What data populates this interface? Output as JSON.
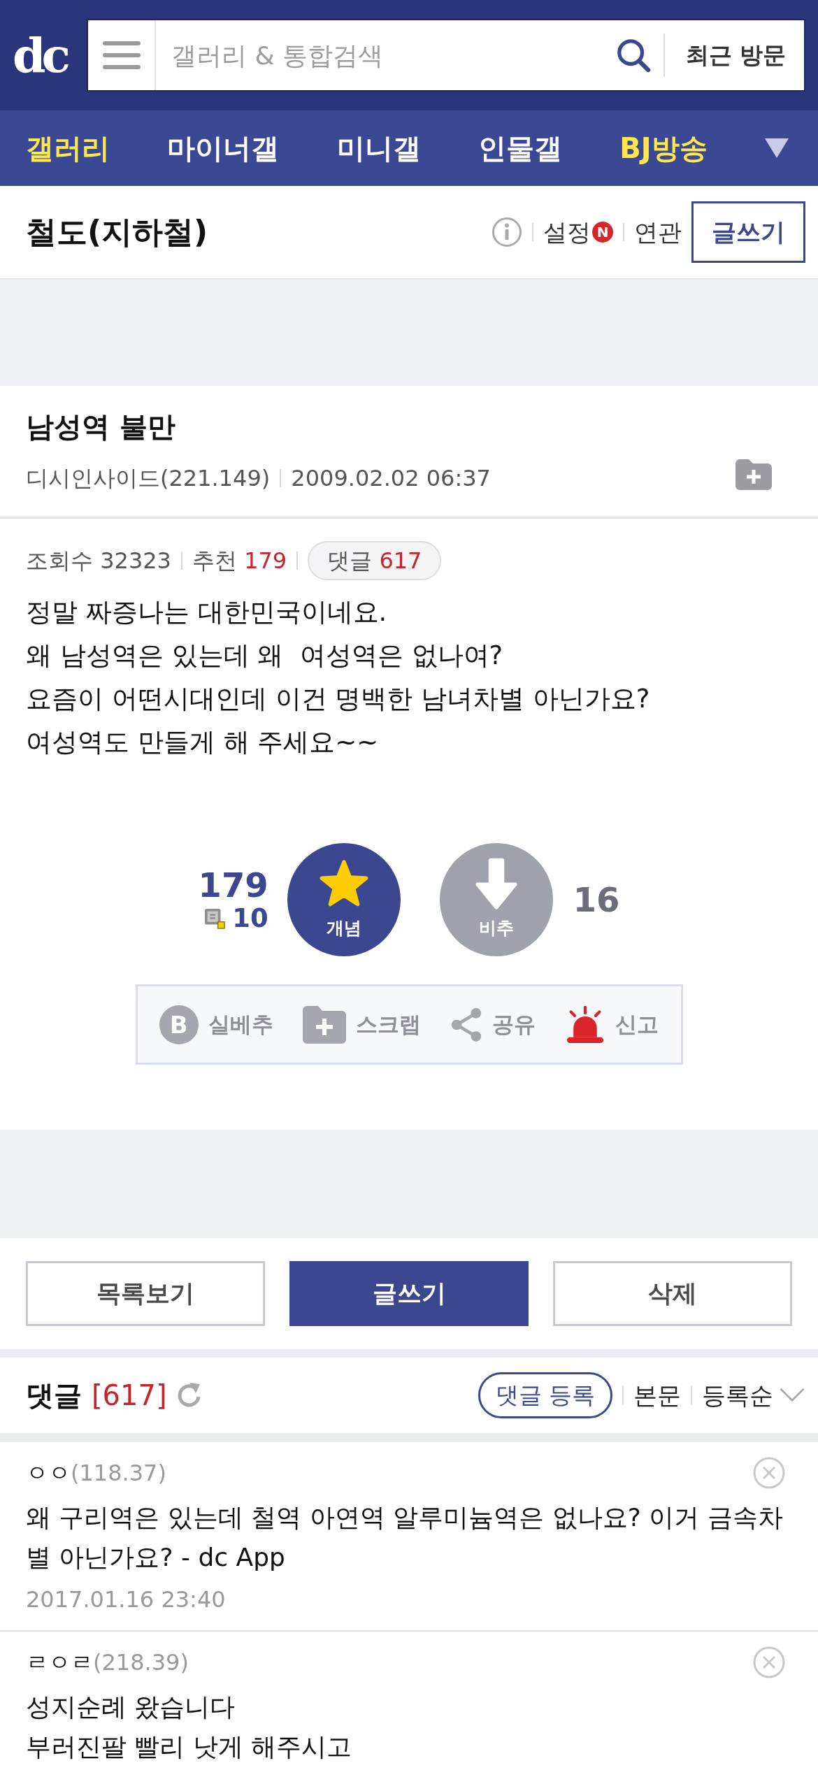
{
  "header": {
    "logo": "dc",
    "search": {
      "placeholder": "갤러리 & 통합검색"
    },
    "recent_button": "최근 방문"
  },
  "nav_tabs": [
    {
      "label": "갤러리",
      "color": "#ffe94a"
    },
    {
      "label": "마이너갤",
      "color": "#ffffff"
    },
    {
      "label": "미니갤",
      "color": "#ffffff"
    },
    {
      "label": "인물갤",
      "color": "#ffffff"
    },
    {
      "label": "BJ방송",
      "color": "#ffe94a"
    }
  ],
  "gallery": {
    "title": "철도(지하철)",
    "settings": {
      "label": "설정",
      "badge": "N"
    },
    "related": "연관",
    "write_button": "글쓰기"
  },
  "post": {
    "title": "남성역 불만",
    "author": "디시인사이드(221.149)",
    "date": "2009.02.02 06:37",
    "views": {
      "label": "조회수",
      "value": "32323"
    },
    "recommends": {
      "label": "추천",
      "value": "179"
    },
    "comments": {
      "label": "댓글",
      "value": "617"
    },
    "body": "정말 짜증나는 대한민국이네요.\n왜 남성역은 있는데 왜  여성역은 없나여?\n요즘이 어떤시대인데 이건 명백한 남녀차별 아닌가요?\n여성역도 만들게 해 주세요~~"
  },
  "vote": {
    "up_count": "179",
    "fixed_up_count": "10",
    "up_label": "개념",
    "down_label": "비추",
    "down_count": "16"
  },
  "actions": [
    {
      "kind": "best",
      "badge": "B",
      "label": "실베추"
    },
    {
      "kind": "scrap",
      "label": "스크랩"
    },
    {
      "kind": "share",
      "label": "공유"
    },
    {
      "kind": "report",
      "label": "신고"
    }
  ],
  "bottom_buttons": [
    {
      "kind": "outline",
      "label": "목록보기"
    },
    {
      "kind": "filled",
      "label": "글쓰기"
    },
    {
      "kind": "outline",
      "label": "삭제"
    }
  ],
  "comment_section": {
    "title": "댓글",
    "count": "[617]",
    "register_button": "댓글 등록",
    "links": [
      {
        "kind": "plain",
        "label": "본문"
      },
      {
        "kind": "dropdown",
        "label": "등록순"
      }
    ]
  },
  "comments": [
    {
      "name": "ㅇㅇ",
      "ip": "(118.37)",
      "text": "왜 구리역은 있는데 철역 아연역 알루미늄역은 없나요? 이거 금속차별 아닌가요? - dc App",
      "date": "2017.01.16 23:40"
    },
    {
      "name": "ㄹㅇㄹ",
      "ip": "(218.39)",
      "text": "성지순례 왔습니다\n부러진팔 빨리 낫게 해주시고"
    }
  ]
}
